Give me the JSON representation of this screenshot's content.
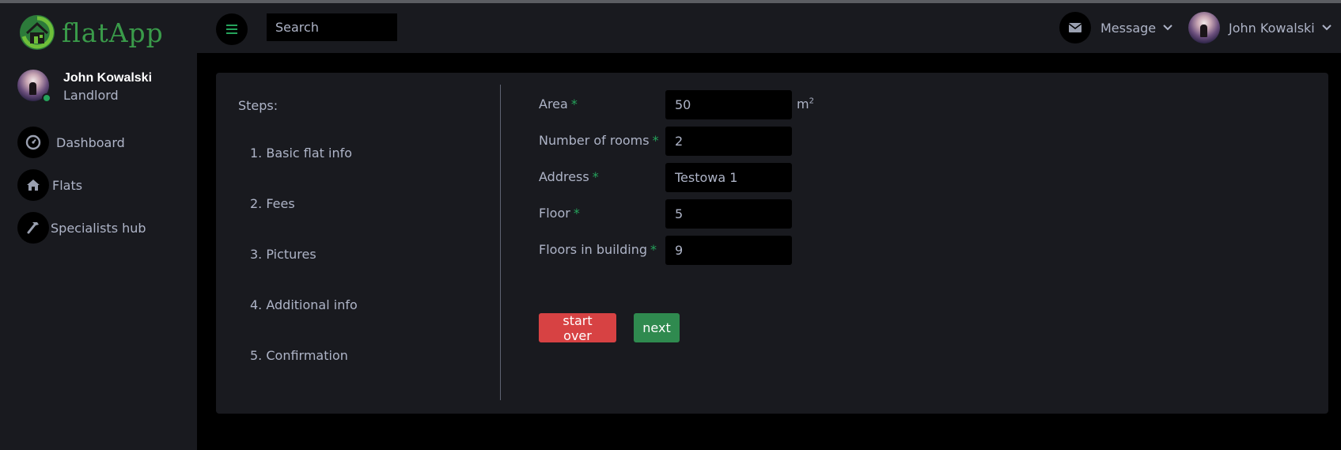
{
  "app": {
    "name": "flatApp"
  },
  "sidebar": {
    "user": {
      "name": "John Kowalski",
      "role": "Landlord"
    },
    "items": [
      {
        "label": "Dashboard",
        "icon": "gauge-icon"
      },
      {
        "label": "Flats",
        "icon": "home-icon"
      },
      {
        "label": "Specialists hub",
        "icon": "hammer-icon"
      }
    ]
  },
  "header": {
    "search_placeholder": "Search",
    "message_label": "Message",
    "user_name": "John Kowalski"
  },
  "steps": {
    "title": "Steps:",
    "items": [
      "1. Basic flat info",
      "2. Fees",
      "3. Pictures",
      "4. Additional info",
      "5. Confirmation"
    ]
  },
  "form": {
    "fields": [
      {
        "label": "Area",
        "required_mark": "*",
        "value": "50",
        "unit": "m",
        "unit_sup": "2"
      },
      {
        "label": "Number of rooms",
        "required_mark": "*",
        "value": "2"
      },
      {
        "label": "Address",
        "required_mark": "*",
        "value": "Testowa 1"
      },
      {
        "label": "Floor",
        "required_mark": "*",
        "value": "5"
      },
      {
        "label": "Floors in building",
        "required_mark": "*",
        "value": "9"
      }
    ],
    "start_over_label": "start over",
    "next_label": "next"
  },
  "colors": {
    "accent_green": "#25a35b",
    "danger_red": "#d74243",
    "panel_bg": "#191a1f",
    "page_bg": "#000000"
  }
}
